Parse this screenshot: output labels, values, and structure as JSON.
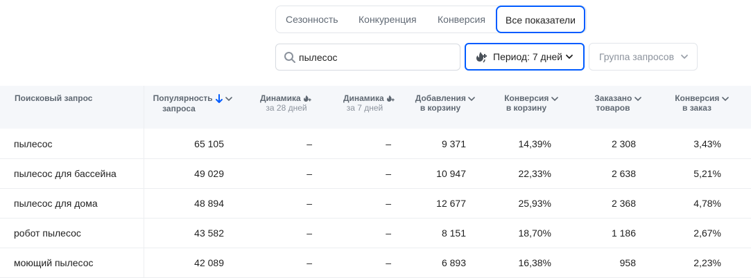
{
  "tabs": [
    {
      "label": "Сезонность",
      "active": false
    },
    {
      "label": "Конкуренция",
      "active": false
    },
    {
      "label": "Конверсия",
      "active": false
    },
    {
      "label": "Все показатели",
      "active": true
    }
  ],
  "search": {
    "value": "пылесос",
    "icon": "search-icon"
  },
  "period": {
    "label": "Период: 7 дней",
    "icon": "flame-plus-icon"
  },
  "query_group": {
    "label": "Группа запросов"
  },
  "accent_color": "#005bff",
  "table": {
    "headers": {
      "query": "Поисковый запрос",
      "popularity_l1": "Популярность",
      "popularity_l2": "запроса",
      "dyn28_l1": "Динамика",
      "dyn28_l2": "за 28 дней",
      "dyn7_l1": "Динамика",
      "dyn7_l2": "за 7 дней",
      "cart_l1": "Добавления",
      "cart_l2": "в корзину",
      "cartconv_l1": "Конверсия",
      "cartconv_l2": "в корзину",
      "ordered_l1": "Заказано",
      "ordered_l2": "товаров",
      "orderconv_l1": "Конверсия",
      "orderconv_l2": "в заказ"
    },
    "rows": [
      {
        "query": "пылесос",
        "popularity": "65 105",
        "dyn28": "–",
        "dyn7": "–",
        "cart_adds": "9 371",
        "cart_conv": "14,39%",
        "ordered": "2 308",
        "order_conv": "3,43%"
      },
      {
        "query": "пылесос для бассейна",
        "popularity": "49 029",
        "dyn28": "–",
        "dyn7": "–",
        "cart_adds": "10 947",
        "cart_conv": "22,33%",
        "ordered": "2 638",
        "order_conv": "5,21%"
      },
      {
        "query": "пылесос для дома",
        "popularity": "48 894",
        "dyn28": "–",
        "dyn7": "–",
        "cart_adds": "12 677",
        "cart_conv": "25,93%",
        "ordered": "2 368",
        "order_conv": "4,78%"
      },
      {
        "query": "робот пылесос",
        "popularity": "43 582",
        "dyn28": "–",
        "dyn7": "–",
        "cart_adds": "8 151",
        "cart_conv": "18,70%",
        "ordered": "1 186",
        "order_conv": "2,67%"
      },
      {
        "query": "моющий пылесос",
        "popularity": "42 089",
        "dyn28": "–",
        "dyn7": "–",
        "cart_adds": "6 893",
        "cart_conv": "16,38%",
        "ordered": "958",
        "order_conv": "2,23%"
      }
    ]
  }
}
